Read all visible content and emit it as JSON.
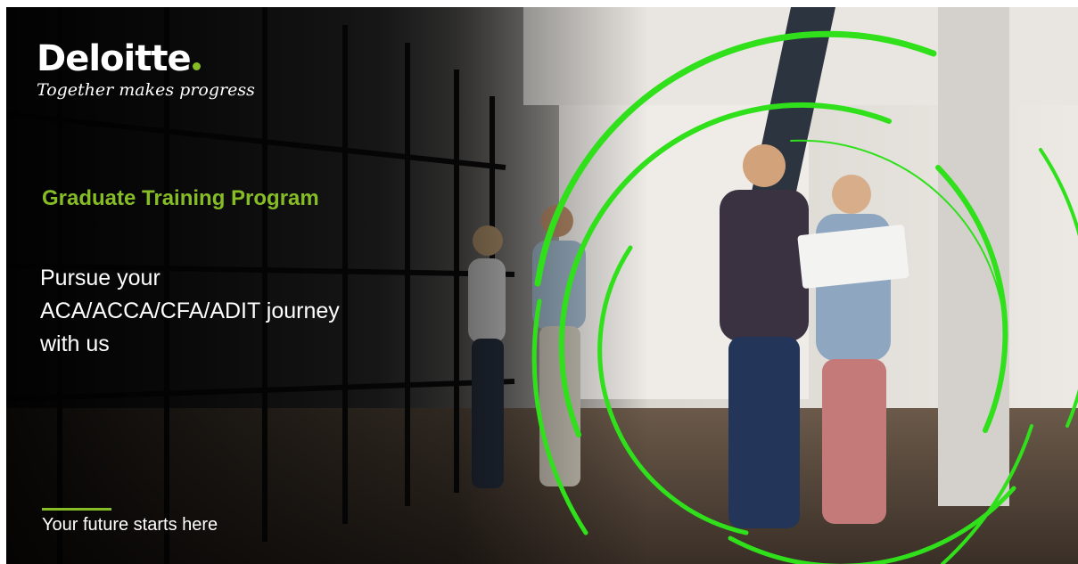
{
  "brand": {
    "logo_text": "Deloitte",
    "tagline": "Together makes progress",
    "accent_color": "#86bc25",
    "ring_color": "#2fe01a"
  },
  "hero": {
    "program_title": "Graduate Training Program",
    "headline_lines": [
      "Pursue your",
      "ACA/ACCA/CFA/ADIT journey",
      "with us"
    ],
    "footer": "Your future starts here"
  },
  "icons": [
    "deloitte-logo-dot-icon",
    "green-ring-icon"
  ]
}
